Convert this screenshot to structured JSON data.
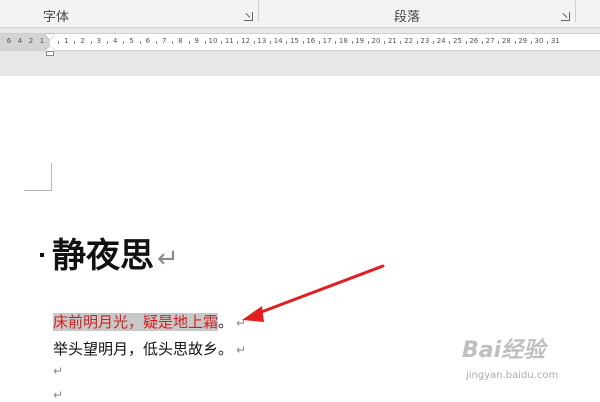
{
  "ribbon": {
    "groups": [
      {
        "label": "字体"
      },
      {
        "label": "段落"
      }
    ]
  },
  "ruler": {
    "left_numbers": [
      "6",
      "4",
      "2",
      "1"
    ],
    "numbers": [
      "1",
      "2",
      "3",
      "4",
      "5",
      "6",
      "7",
      "8",
      "9",
      "10",
      "11",
      "12",
      "13",
      "14",
      "15",
      "16",
      "17",
      "18",
      "19",
      "20",
      "21",
      "22",
      "23",
      "24",
      "25",
      "26",
      "27",
      "28",
      "29",
      "30",
      "31"
    ]
  },
  "document": {
    "title": "静夜思",
    "paragraph_mark": "↵",
    "lines": [
      {
        "text": "床前明月光，疑是地上霜",
        "punct": "。",
        "selected": true
      },
      {
        "text": "举头望明月，低头思故乡。",
        "selected": false
      }
    ]
  },
  "annotation": {
    "arrow_color": "#e02020"
  },
  "watermark": {
    "logo": "Bai经验",
    "url": "jingyan.baidu.com"
  },
  "colors": {
    "selection_bg": "#c8c8c8",
    "selected_text": "#d42020",
    "ribbon_bg": "#f3f3f3",
    "ruler_band": "#e8e8e8"
  }
}
